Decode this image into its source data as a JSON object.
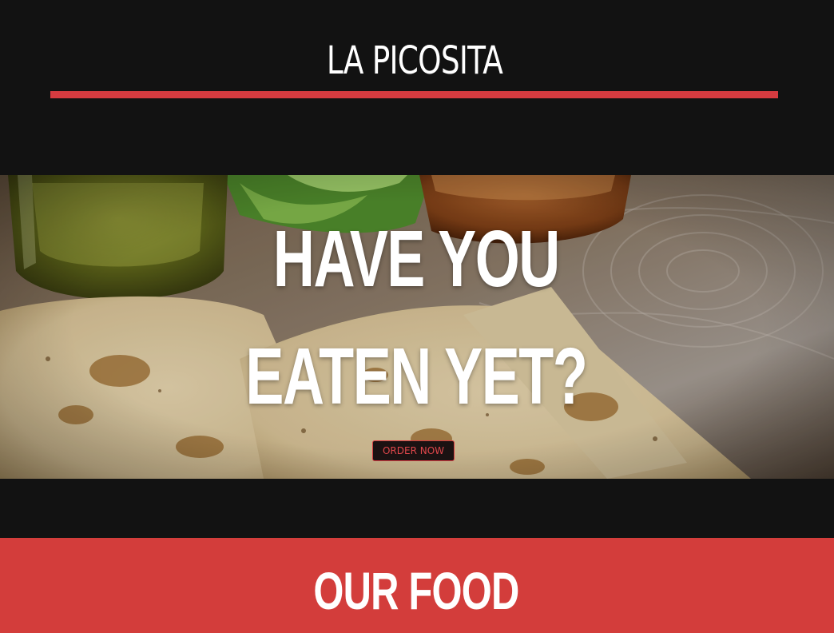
{
  "header": {
    "brand": "LA PICOSITA",
    "accent_color": "#d63b40"
  },
  "hero": {
    "headline_line_1": "HAVE YOU",
    "headline_line_2": "EATEN YET?",
    "cta_label": "ORDER NOW",
    "image_alt": "Quesadillas with salsa verde, red salsa and lettuce on a wooden board"
  },
  "sections": {
    "food_title": "OUR FOOD",
    "food_band_color": "#d33d3b"
  }
}
